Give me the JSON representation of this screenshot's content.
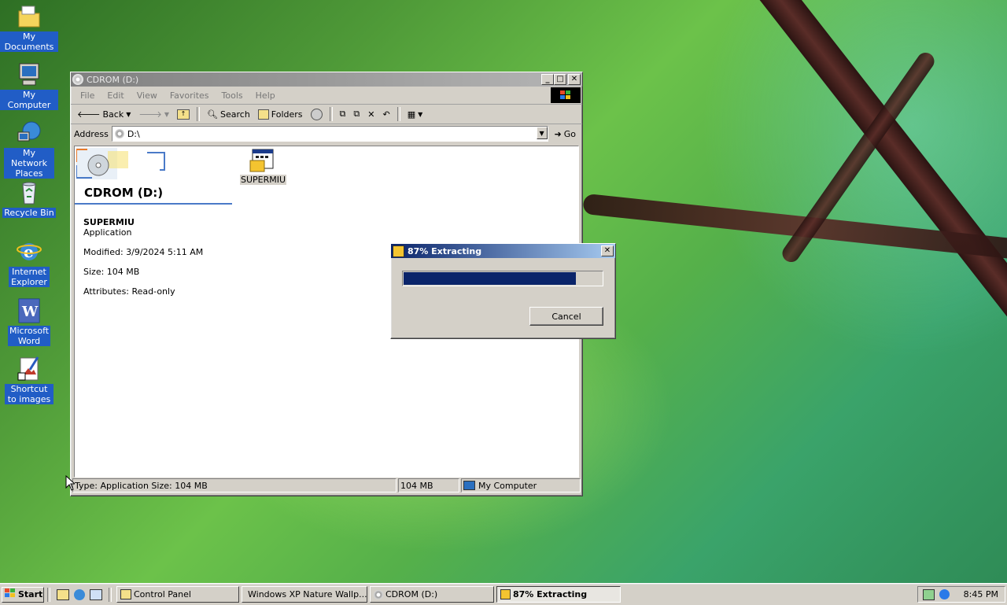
{
  "desktop": {
    "icons": [
      {
        "label": "My Documents",
        "icon": "folder-icon"
      },
      {
        "label": "My Computer",
        "icon": "computer-icon"
      },
      {
        "label": "My Network Places",
        "icon": "network-icon"
      },
      {
        "label": "Recycle Bin",
        "icon": "recycle-bin-icon"
      },
      {
        "label": "Internet Explorer",
        "icon": "ie-icon"
      },
      {
        "label": "Microsoft Word",
        "icon": "word-icon"
      },
      {
        "label": "Shortcut to images",
        "icon": "shortcut-icon"
      }
    ]
  },
  "explorer": {
    "title": "CDROM (D:)",
    "menu": [
      "File",
      "Edit",
      "View",
      "Favorites",
      "Tools",
      "Help"
    ],
    "toolbar": {
      "back": "Back",
      "search": "Search",
      "folders": "Folders"
    },
    "address": {
      "label": "Address",
      "value": "D:\\",
      "go": "Go"
    },
    "panel": {
      "drive_title": "CDROM (D:)",
      "item_name": "SUPERMIU",
      "item_type": "Application",
      "modified": "Modified: 3/9/2024 5:11 AM",
      "size": "Size: 104 MB",
      "attributes": "Attributes: Read-only"
    },
    "file": {
      "name": "SUPERMIU"
    },
    "status": {
      "info": "Type: Application Size: 104 MB",
      "size": "104 MB",
      "zone": "My Computer"
    }
  },
  "dialog": {
    "title": "87% Extracting",
    "progress": 0.87,
    "cancel": "Cancel"
  },
  "taskbar": {
    "start": "Start",
    "tasks": [
      {
        "label": "Control Panel",
        "active": false
      },
      {
        "label": "Windows XP Nature Wallp...",
        "active": false
      },
      {
        "label": "CDROM (D:)",
        "active": false
      },
      {
        "label": "87% Extracting",
        "active": true
      }
    ],
    "clock": "8:45 PM"
  },
  "colors": {
    "title_active": "#0a246a",
    "progress": "#0a246a",
    "desktop_label_bg": "#215dc6"
  }
}
